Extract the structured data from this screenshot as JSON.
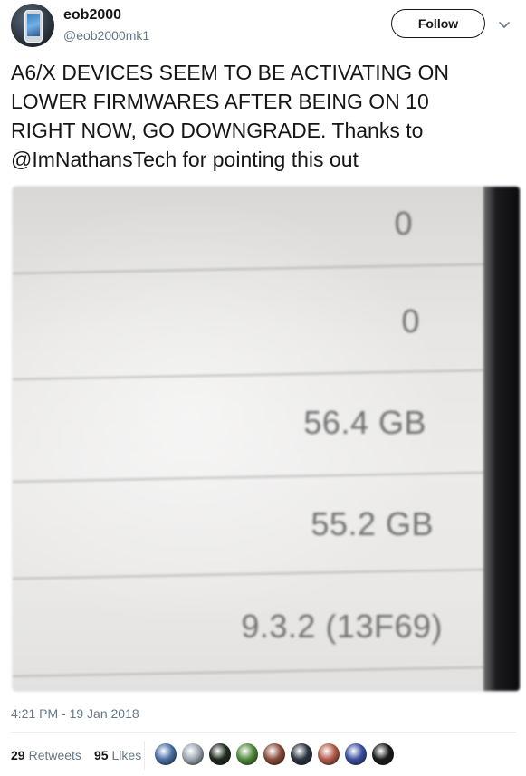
{
  "user": {
    "name": "eob2000",
    "handle": "@eob2000mk1"
  },
  "follow_label": "Follow",
  "tweet_text": "A6/X DEVICES SEEM TO BE ACTIVATING ON\nLOWER FIRMWARES AFTER BEING ON 10\nRIGHT NOW, GO DOWNGRADE. Thanks to\n@ImNathansTech for pointing this out",
  "photo": {
    "values": [
      "0",
      "0",
      "56.4 GB",
      "55.2 GB",
      "9.3.2 (13F69)"
    ]
  },
  "timestamp": "4:21 PM - 19 Jan 2018",
  "stats": {
    "retweets_count": "29",
    "retweets_label": "Retweets",
    "likes_count": "95",
    "likes_label": "Likes"
  },
  "likers": [
    {
      "color": "#4a6fa5"
    },
    {
      "color": "#9aa5b1"
    },
    {
      "color": "#1f2a1f"
    },
    {
      "color": "#4f8a3a"
    },
    {
      "color": "#8a4b3a"
    },
    {
      "color": "#2b3440"
    },
    {
      "color": "#b25a4a"
    },
    {
      "color": "#3a4fa0"
    },
    {
      "color": "#1a1a1a"
    }
  ]
}
